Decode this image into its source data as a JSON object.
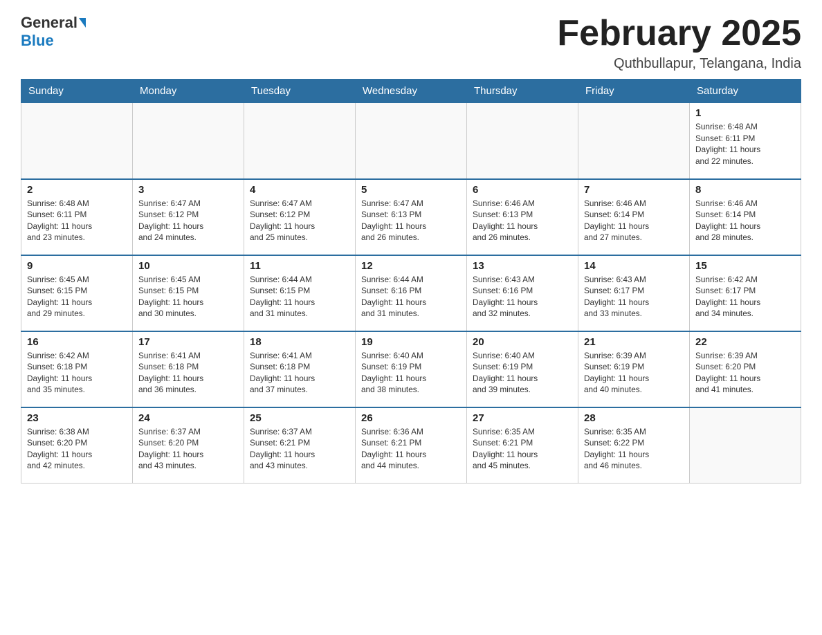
{
  "header": {
    "logo_general": "General",
    "logo_blue": "Blue",
    "title": "February 2025",
    "location": "Quthbullapur, Telangana, India"
  },
  "weekdays": [
    "Sunday",
    "Monday",
    "Tuesday",
    "Wednesday",
    "Thursday",
    "Friday",
    "Saturday"
  ],
  "weeks": [
    [
      {
        "day": "",
        "info": ""
      },
      {
        "day": "",
        "info": ""
      },
      {
        "day": "",
        "info": ""
      },
      {
        "day": "",
        "info": ""
      },
      {
        "day": "",
        "info": ""
      },
      {
        "day": "",
        "info": ""
      },
      {
        "day": "1",
        "info": "Sunrise: 6:48 AM\nSunset: 6:11 PM\nDaylight: 11 hours\nand 22 minutes."
      }
    ],
    [
      {
        "day": "2",
        "info": "Sunrise: 6:48 AM\nSunset: 6:11 PM\nDaylight: 11 hours\nand 23 minutes."
      },
      {
        "day": "3",
        "info": "Sunrise: 6:47 AM\nSunset: 6:12 PM\nDaylight: 11 hours\nand 24 minutes."
      },
      {
        "day": "4",
        "info": "Sunrise: 6:47 AM\nSunset: 6:12 PM\nDaylight: 11 hours\nand 25 minutes."
      },
      {
        "day": "5",
        "info": "Sunrise: 6:47 AM\nSunset: 6:13 PM\nDaylight: 11 hours\nand 26 minutes."
      },
      {
        "day": "6",
        "info": "Sunrise: 6:46 AM\nSunset: 6:13 PM\nDaylight: 11 hours\nand 26 minutes."
      },
      {
        "day": "7",
        "info": "Sunrise: 6:46 AM\nSunset: 6:14 PM\nDaylight: 11 hours\nand 27 minutes."
      },
      {
        "day": "8",
        "info": "Sunrise: 6:46 AM\nSunset: 6:14 PM\nDaylight: 11 hours\nand 28 minutes."
      }
    ],
    [
      {
        "day": "9",
        "info": "Sunrise: 6:45 AM\nSunset: 6:15 PM\nDaylight: 11 hours\nand 29 minutes."
      },
      {
        "day": "10",
        "info": "Sunrise: 6:45 AM\nSunset: 6:15 PM\nDaylight: 11 hours\nand 30 minutes."
      },
      {
        "day": "11",
        "info": "Sunrise: 6:44 AM\nSunset: 6:15 PM\nDaylight: 11 hours\nand 31 minutes."
      },
      {
        "day": "12",
        "info": "Sunrise: 6:44 AM\nSunset: 6:16 PM\nDaylight: 11 hours\nand 31 minutes."
      },
      {
        "day": "13",
        "info": "Sunrise: 6:43 AM\nSunset: 6:16 PM\nDaylight: 11 hours\nand 32 minutes."
      },
      {
        "day": "14",
        "info": "Sunrise: 6:43 AM\nSunset: 6:17 PM\nDaylight: 11 hours\nand 33 minutes."
      },
      {
        "day": "15",
        "info": "Sunrise: 6:42 AM\nSunset: 6:17 PM\nDaylight: 11 hours\nand 34 minutes."
      }
    ],
    [
      {
        "day": "16",
        "info": "Sunrise: 6:42 AM\nSunset: 6:18 PM\nDaylight: 11 hours\nand 35 minutes."
      },
      {
        "day": "17",
        "info": "Sunrise: 6:41 AM\nSunset: 6:18 PM\nDaylight: 11 hours\nand 36 minutes."
      },
      {
        "day": "18",
        "info": "Sunrise: 6:41 AM\nSunset: 6:18 PM\nDaylight: 11 hours\nand 37 minutes."
      },
      {
        "day": "19",
        "info": "Sunrise: 6:40 AM\nSunset: 6:19 PM\nDaylight: 11 hours\nand 38 minutes."
      },
      {
        "day": "20",
        "info": "Sunrise: 6:40 AM\nSunset: 6:19 PM\nDaylight: 11 hours\nand 39 minutes."
      },
      {
        "day": "21",
        "info": "Sunrise: 6:39 AM\nSunset: 6:19 PM\nDaylight: 11 hours\nand 40 minutes."
      },
      {
        "day": "22",
        "info": "Sunrise: 6:39 AM\nSunset: 6:20 PM\nDaylight: 11 hours\nand 41 minutes."
      }
    ],
    [
      {
        "day": "23",
        "info": "Sunrise: 6:38 AM\nSunset: 6:20 PM\nDaylight: 11 hours\nand 42 minutes."
      },
      {
        "day": "24",
        "info": "Sunrise: 6:37 AM\nSunset: 6:20 PM\nDaylight: 11 hours\nand 43 minutes."
      },
      {
        "day": "25",
        "info": "Sunrise: 6:37 AM\nSunset: 6:21 PM\nDaylight: 11 hours\nand 43 minutes."
      },
      {
        "day": "26",
        "info": "Sunrise: 6:36 AM\nSunset: 6:21 PM\nDaylight: 11 hours\nand 44 minutes."
      },
      {
        "day": "27",
        "info": "Sunrise: 6:35 AM\nSunset: 6:21 PM\nDaylight: 11 hours\nand 45 minutes."
      },
      {
        "day": "28",
        "info": "Sunrise: 6:35 AM\nSunset: 6:22 PM\nDaylight: 11 hours\nand 46 minutes."
      },
      {
        "day": "",
        "info": ""
      }
    ]
  ]
}
